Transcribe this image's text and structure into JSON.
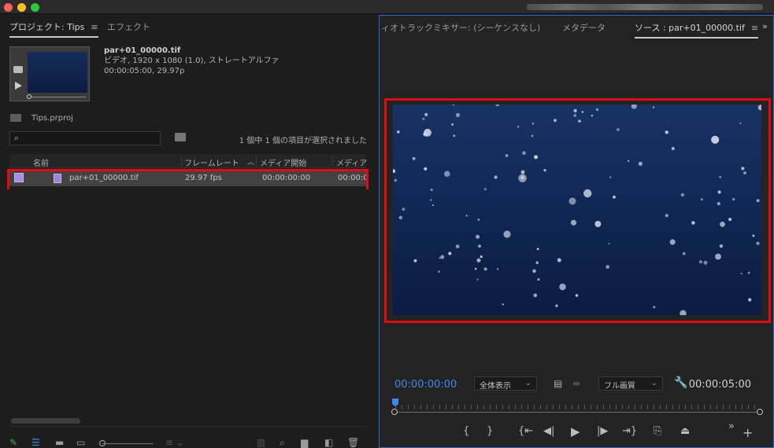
{
  "app": {
    "accent_color": "#3b8bef",
    "highlight_color": "#e50914"
  },
  "project_panel": {
    "tabs": [
      "プロジェクト: Tips",
      "エフェクト"
    ],
    "menu_icon": "hamburger-icon",
    "clip_info": {
      "filename": "par+01_00000.tif",
      "line2": "ビデオ, 1920 x 1080 (1.0), ストレートアルファ",
      "line3": "00:00:05:00, 29.97p"
    },
    "project_file": "Tips.prproj",
    "search_placeholder": "",
    "selection_status": "1 個中 1 個の項目が選択されました",
    "columns": [
      "名前",
      "フレームレート",
      "メディア開始",
      "メディア"
    ],
    "rows": [
      {
        "name": "par+01_00000.tif",
        "frame_rate": "29.97 fps",
        "media_start": "00:00:00:00",
        "media_end": "00:00:0"
      }
    ]
  },
  "source_panel": {
    "tabs": [
      "ィオトラックミキサー: (シーケンスなし)",
      "メタデータ",
      "ソース : par+01_00000.tif"
    ],
    "overflow": "»",
    "timecode_current": "00:00:00:00",
    "timecode_duration": "00:00:05:00",
    "zoom_select": "全体表示",
    "quality_select": "フル画質"
  }
}
